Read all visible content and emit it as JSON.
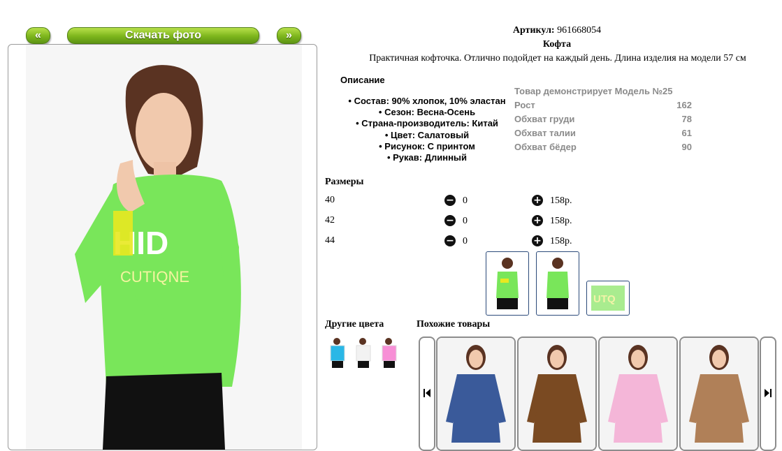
{
  "nav": {
    "prev_label": "«",
    "download_label": "Скачать фото",
    "next_label": "»"
  },
  "product": {
    "article_label": "Артикул:",
    "article_value": "961668054",
    "title": "Кофта",
    "subtitle": "Практичная кофточка. Отлично подойдет на каждый день. Длина изделия на модели 57 см",
    "description_heading": "Описание",
    "features": [
      "Состав: 90% хлопок, 10% эластан",
      "Сезон: Весна-Осень",
      "Страна-производитель: Китай",
      "Цвет: Салатовый",
      "Рисунок: С принтом",
      "Рукав: Длинный"
    ],
    "shirt_color": "#79e65a"
  },
  "model": {
    "heading": "Товар демонстрирует Модель №25",
    "rows": [
      {
        "label": "Рост",
        "value": "162"
      },
      {
        "label": "Обхват груди",
        "value": "78"
      },
      {
        "label": "Обхват талии",
        "value": "61"
      },
      {
        "label": "Обхват бёдер",
        "value": "90"
      }
    ]
  },
  "sizes": {
    "heading": "Размеры",
    "rows": [
      {
        "size": "40",
        "qty": "0",
        "price": "158р."
      },
      {
        "size": "42",
        "qty": "0",
        "price": "158р."
      },
      {
        "size": "44",
        "qty": "0",
        "price": "158р."
      }
    ]
  },
  "other_colors": {
    "heading": "Другие цвета",
    "colors": [
      "#2ab7e6",
      "#f2f2f2",
      "#f78fd6"
    ]
  },
  "similar": {
    "heading": "Похожие товары",
    "prev_icon": "skip-back-icon",
    "next_icon": "skip-forward-icon",
    "items": [
      {
        "color": "#3a5a9a"
      },
      {
        "color": "#7a4a22"
      },
      {
        "color": "#f4b6d8"
      },
      {
        "color": "#b08058"
      }
    ]
  }
}
